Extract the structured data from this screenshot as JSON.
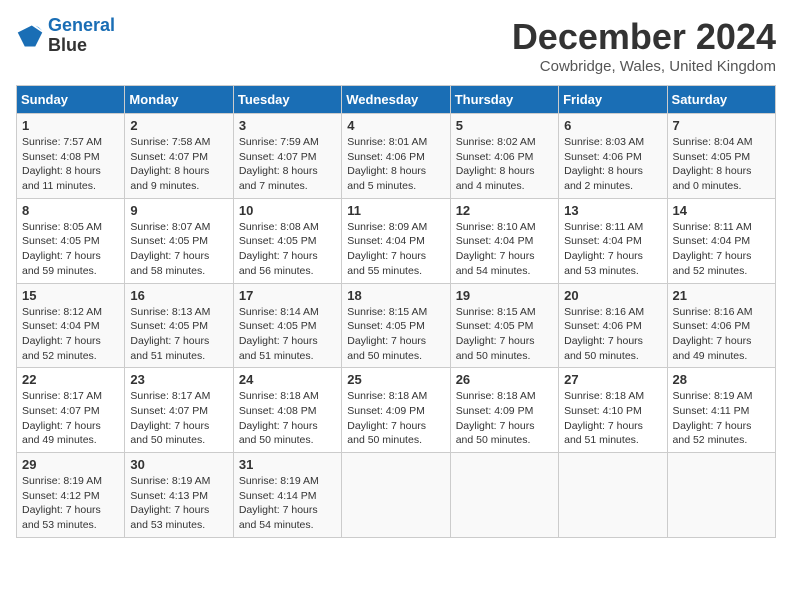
{
  "header": {
    "logo_line1": "General",
    "logo_line2": "Blue",
    "month_title": "December 2024",
    "location": "Cowbridge, Wales, United Kingdom"
  },
  "days_of_week": [
    "Sunday",
    "Monday",
    "Tuesday",
    "Wednesday",
    "Thursday",
    "Friday",
    "Saturday"
  ],
  "weeks": [
    [
      {
        "day": "1",
        "sunrise": "7:57 AM",
        "sunset": "4:08 PM",
        "daylight": "8 hours and 11 minutes."
      },
      {
        "day": "2",
        "sunrise": "7:58 AM",
        "sunset": "4:07 PM",
        "daylight": "8 hours and 9 minutes."
      },
      {
        "day": "3",
        "sunrise": "7:59 AM",
        "sunset": "4:07 PM",
        "daylight": "8 hours and 7 minutes."
      },
      {
        "day": "4",
        "sunrise": "8:01 AM",
        "sunset": "4:06 PM",
        "daylight": "8 hours and 5 minutes."
      },
      {
        "day": "5",
        "sunrise": "8:02 AM",
        "sunset": "4:06 PM",
        "daylight": "8 hours and 4 minutes."
      },
      {
        "day": "6",
        "sunrise": "8:03 AM",
        "sunset": "4:06 PM",
        "daylight": "8 hours and 2 minutes."
      },
      {
        "day": "7",
        "sunrise": "8:04 AM",
        "sunset": "4:05 PM",
        "daylight": "8 hours and 0 minutes."
      }
    ],
    [
      {
        "day": "8",
        "sunrise": "8:05 AM",
        "sunset": "4:05 PM",
        "daylight": "7 hours and 59 minutes."
      },
      {
        "day": "9",
        "sunrise": "8:07 AM",
        "sunset": "4:05 PM",
        "daylight": "7 hours and 58 minutes."
      },
      {
        "day": "10",
        "sunrise": "8:08 AM",
        "sunset": "4:05 PM",
        "daylight": "7 hours and 56 minutes."
      },
      {
        "day": "11",
        "sunrise": "8:09 AM",
        "sunset": "4:04 PM",
        "daylight": "7 hours and 55 minutes."
      },
      {
        "day": "12",
        "sunrise": "8:10 AM",
        "sunset": "4:04 PM",
        "daylight": "7 hours and 54 minutes."
      },
      {
        "day": "13",
        "sunrise": "8:11 AM",
        "sunset": "4:04 PM",
        "daylight": "7 hours and 53 minutes."
      },
      {
        "day": "14",
        "sunrise": "8:11 AM",
        "sunset": "4:04 PM",
        "daylight": "7 hours and 52 minutes."
      }
    ],
    [
      {
        "day": "15",
        "sunrise": "8:12 AM",
        "sunset": "4:04 PM",
        "daylight": "7 hours and 52 minutes."
      },
      {
        "day": "16",
        "sunrise": "8:13 AM",
        "sunset": "4:05 PM",
        "daylight": "7 hours and 51 minutes."
      },
      {
        "day": "17",
        "sunrise": "8:14 AM",
        "sunset": "4:05 PM",
        "daylight": "7 hours and 51 minutes."
      },
      {
        "day": "18",
        "sunrise": "8:15 AM",
        "sunset": "4:05 PM",
        "daylight": "7 hours and 50 minutes."
      },
      {
        "day": "19",
        "sunrise": "8:15 AM",
        "sunset": "4:05 PM",
        "daylight": "7 hours and 50 minutes."
      },
      {
        "day": "20",
        "sunrise": "8:16 AM",
        "sunset": "4:06 PM",
        "daylight": "7 hours and 50 minutes."
      },
      {
        "day": "21",
        "sunrise": "8:16 AM",
        "sunset": "4:06 PM",
        "daylight": "7 hours and 49 minutes."
      }
    ],
    [
      {
        "day": "22",
        "sunrise": "8:17 AM",
        "sunset": "4:07 PM",
        "daylight": "7 hours and 49 minutes."
      },
      {
        "day": "23",
        "sunrise": "8:17 AM",
        "sunset": "4:07 PM",
        "daylight": "7 hours and 50 minutes."
      },
      {
        "day": "24",
        "sunrise": "8:18 AM",
        "sunset": "4:08 PM",
        "daylight": "7 hours and 50 minutes."
      },
      {
        "day": "25",
        "sunrise": "8:18 AM",
        "sunset": "4:09 PM",
        "daylight": "7 hours and 50 minutes."
      },
      {
        "day": "26",
        "sunrise": "8:18 AM",
        "sunset": "4:09 PM",
        "daylight": "7 hours and 50 minutes."
      },
      {
        "day": "27",
        "sunrise": "8:18 AM",
        "sunset": "4:10 PM",
        "daylight": "7 hours and 51 minutes."
      },
      {
        "day": "28",
        "sunrise": "8:19 AM",
        "sunset": "4:11 PM",
        "daylight": "7 hours and 52 minutes."
      }
    ],
    [
      {
        "day": "29",
        "sunrise": "8:19 AM",
        "sunset": "4:12 PM",
        "daylight": "7 hours and 53 minutes."
      },
      {
        "day": "30",
        "sunrise": "8:19 AM",
        "sunset": "4:13 PM",
        "daylight": "7 hours and 53 minutes."
      },
      {
        "day": "31",
        "sunrise": "8:19 AM",
        "sunset": "4:14 PM",
        "daylight": "7 hours and 54 minutes."
      },
      null,
      null,
      null,
      null
    ]
  ]
}
